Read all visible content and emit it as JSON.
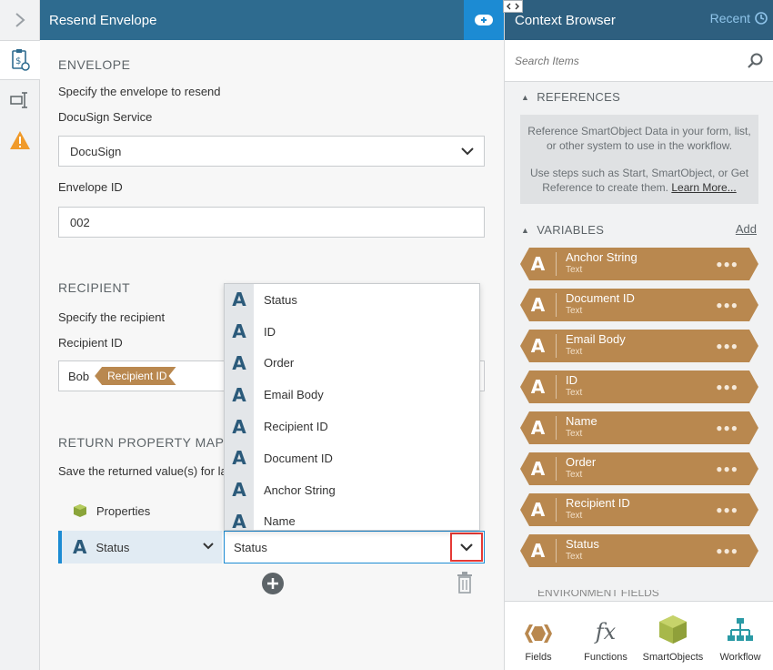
{
  "main": {
    "title": "Resend Envelope",
    "envelope": {
      "section": "ENVELOPE",
      "desc": "Specify the envelope to resend",
      "service_label": "DocuSign Service",
      "service_value": "DocuSign",
      "id_label": "Envelope ID",
      "id_value": "002"
    },
    "recipient": {
      "section": "RECIPIENT",
      "desc": "Specify the recipient",
      "id_label": "Recipient ID",
      "value_prefix": "Bob",
      "token": "Recipient ID"
    },
    "mapping": {
      "section": "RETURN PROPERTY MAPPIN",
      "desc": "Save the returned value(s) for la",
      "properties_label": "Properties",
      "source_label": "Status",
      "target_value": "Status"
    },
    "dropdown_items": [
      "Status",
      "ID",
      "Order",
      "Email Body",
      "Recipient ID",
      "Document ID",
      "Anchor String",
      "Name"
    ]
  },
  "context_browser": {
    "title": "Context Browser",
    "recent_label": "Recent",
    "search_placeholder": "Search Items",
    "references_title": "REFERENCES",
    "references_text1": "Reference SmartObject Data in your form, list, or other system to use in the workflow.",
    "references_text2": "Use steps such as Start, SmartObject, or Get Reference to create them.",
    "learn_more": "Learn More...",
    "variables_title": "VARIABLES",
    "add_label": "Add",
    "variables": [
      {
        "name": "Anchor String",
        "type": "Text"
      },
      {
        "name": "Document ID",
        "type": "Text"
      },
      {
        "name": "Email Body",
        "type": "Text"
      },
      {
        "name": "ID",
        "type": "Text"
      },
      {
        "name": "Name",
        "type": "Text"
      },
      {
        "name": "Order",
        "type": "Text"
      },
      {
        "name": "Recipient ID",
        "type": "Text"
      },
      {
        "name": "Status",
        "type": "Text"
      }
    ],
    "env_fields_peek": "ENVIRONMENT FIELDS",
    "tabs": [
      {
        "label": "Fields",
        "icon": "fields-icon"
      },
      {
        "label": "Functions",
        "icon": "functions-icon"
      },
      {
        "label": "SmartObjects",
        "icon": "smartobjects-icon"
      },
      {
        "label": "Workflow",
        "icon": "workflow-icon"
      }
    ]
  },
  "colors": {
    "header_blue": "#2e6b8f",
    "accent_blue": "#1c8bd3",
    "variable_tan": "#b9884f",
    "highlight_red": "#e53935"
  }
}
